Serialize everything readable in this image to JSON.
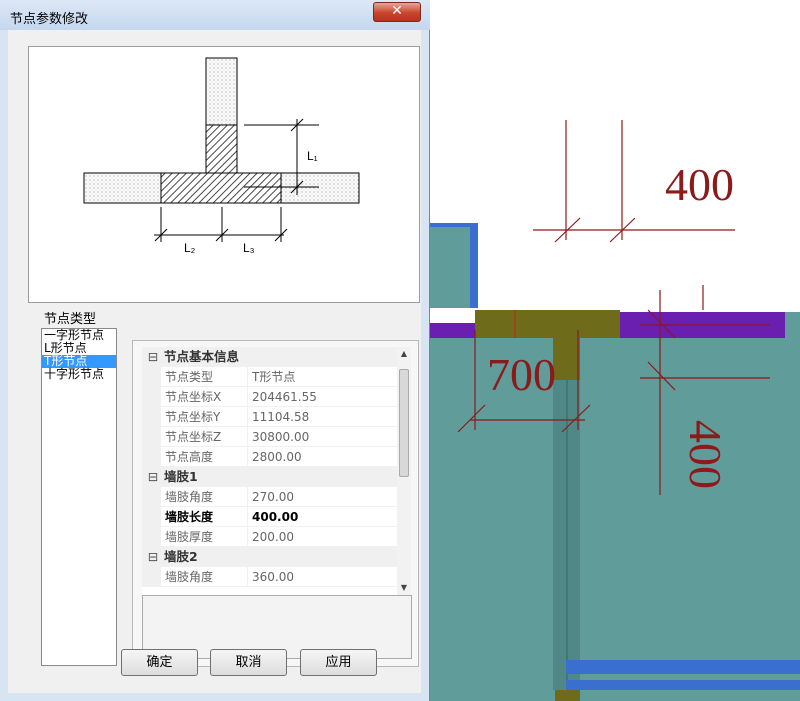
{
  "dialog": {
    "title": "节点参数修改",
    "close_symbol": "✕",
    "diagram_labels": {
      "l1": "L₁",
      "l2": "L₂",
      "l3": "L₃"
    },
    "node_type_label": "节点类型",
    "node_types": [
      {
        "label": "一字形节点",
        "selected": false
      },
      {
        "label": "L形节点",
        "selected": false
      },
      {
        "label": "T形节点",
        "selected": true
      },
      {
        "label": "十字形节点",
        "selected": false
      }
    ],
    "groups": [
      {
        "title": "节点基本信息",
        "toggle": "⊟",
        "rows": [
          {
            "name": "节点类型",
            "value": "T形节点"
          },
          {
            "name": "节点坐标X",
            "value": "204461.55"
          },
          {
            "name": "节点坐标Y",
            "value": "11104.58"
          },
          {
            "name": "节点坐标Z",
            "value": "30800.00"
          },
          {
            "name": "节点高度",
            "value": "2800.00"
          }
        ]
      },
      {
        "title": "墙肢1",
        "toggle": "⊟",
        "rows": [
          {
            "name": "墙肢角度",
            "value": "270.00"
          },
          {
            "name": "墙肢长度",
            "value": "400.00",
            "bold": true
          },
          {
            "name": "墙肢厚度",
            "value": "200.00"
          }
        ]
      },
      {
        "title": "墙肢2",
        "toggle": "⊟",
        "rows": [
          {
            "name": "墙肢角度",
            "value": "360.00"
          }
        ]
      }
    ],
    "buttons": {
      "ok": "确定",
      "cancel": "取消",
      "apply": "应用"
    }
  },
  "cad": {
    "dimensions": {
      "top_right": "400",
      "middle": "700",
      "right_vertical": "400"
    },
    "colors": {
      "wall_fill": "#5f9c9a",
      "wall_purple": "#6a1fb0",
      "joint_olive": "#6e6b1a",
      "dim_text": "#8b1a1a",
      "wall_blue": "#3a6fd0"
    }
  }
}
